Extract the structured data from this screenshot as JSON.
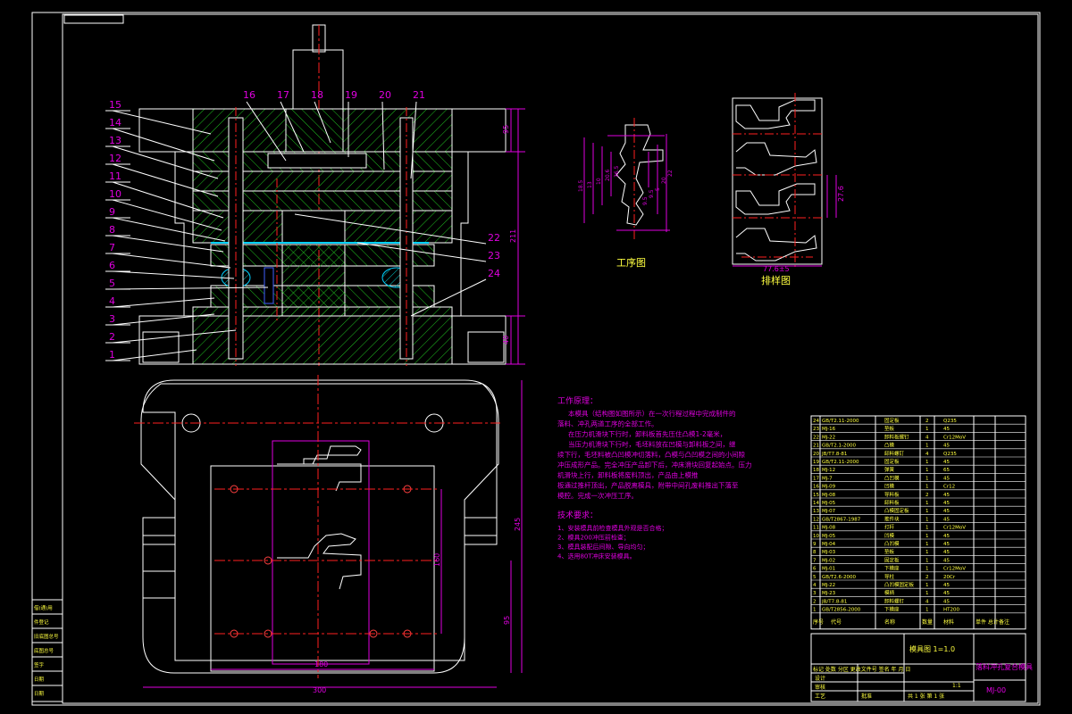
{
  "colors": {
    "background": "#000000",
    "frame": "#ffffff",
    "dimension": "#e000e0",
    "text": "#ffff40",
    "centerline": "#ff2020",
    "steel": "#20c020",
    "highlight": "#00d0ff"
  },
  "callouts_left": [
    "15",
    "14",
    "13",
    "12",
    "11",
    "10",
    "9",
    "8",
    "7",
    "6",
    "5",
    "4",
    "3",
    "2",
    "1"
  ],
  "callouts_top": [
    "16",
    "17",
    "18",
    "19",
    "20",
    "21"
  ],
  "callouts_right": [
    "22",
    "23",
    "24"
  ],
  "section_dims": {
    "top": "95",
    "total": "211",
    "bottom": "40"
  },
  "plan_dims": {
    "height": "245",
    "width_inner": "180",
    "width_total": "300",
    "inner_height": "160",
    "lower": "95"
  },
  "part_drawing": {
    "label": "工序图",
    "dims_left": [
      "18.5",
      "13",
      "10",
      "20.6",
      "36.5"
    ],
    "dims_right": [
      "9.5",
      "9.5",
      "5",
      "20",
      "22"
    ]
  },
  "strip_layout": {
    "label": "排样图",
    "pitch": "27.6",
    "width": "77.6±5"
  },
  "work_principle": {
    "heading": "工作原理：",
    "lines": [
      "本模具（结构图如图所示）在一次行程过程中完成制件的",
      "落料、冲孔两道工序的全部工作。",
      "在压力机滑块下行时，卸料板首先压住凸模1-2毫米，",
      "当压力机滑块下行时，毛坯料放在凹模与卸料板之间，继",
      "续下行，毛坯料被凸凹模冲切落料，凸模与凸凹模之间的小间隙",
      "冲压成形产品。完全冲压产品卸下后，冲床滑块回复起始点。压力",
      "机滑块上行，卸料板将废料顶出，产品由上模推",
      "板通过推杆顶出，产品脱离模具，附带中间孔废料推出下落至",
      "模腔。完成一次冲压工序。"
    ]
  },
  "tech_requirements": {
    "heading": "技术要求：",
    "items": [
      "1、安装模具前检查模具外观是否合格；",
      "2、模具200冲压前检查；",
      "3、模具装配后间隙、导向均匀；",
      "4、选用80T冲床安装模具。"
    ]
  },
  "bom_rows": [
    {
      "code": "GB/T2.11-2000",
      "name": "固定板",
      "qty": "2",
      "mat": "Q235"
    },
    {
      "code": "MJ-16",
      "name": "垫板",
      "qty": "1",
      "mat": "45"
    },
    {
      "code": "MJ-22",
      "name": "卸料板螺钉",
      "qty": "4",
      "mat": "Cr12MoV"
    },
    {
      "code": "GB/T2.1-2000",
      "name": "凸模",
      "qty": "1",
      "mat": "45"
    },
    {
      "code": "JB/T7.8-81",
      "name": "卸料螺钉",
      "qty": "4",
      "mat": "Q235"
    },
    {
      "code": "GB/T2.11-2000",
      "name": "固定板",
      "qty": "1",
      "mat": "45"
    },
    {
      "code": "MJ-12",
      "name": "弹簧",
      "qty": "1",
      "mat": "65"
    },
    {
      "code": "MJ-7",
      "name": "凸凹模",
      "qty": "1",
      "mat": "45"
    },
    {
      "code": "MJ-09",
      "name": "凹模",
      "qty": "1",
      "mat": "Cr12"
    },
    {
      "code": "MJ-08",
      "name": "导料板",
      "qty": "2",
      "mat": "45"
    },
    {
      "code": "MJ-05",
      "name": "卸料板",
      "qty": "1",
      "mat": "45"
    },
    {
      "code": "MJ-07",
      "name": "凸模固定板",
      "qty": "1",
      "mat": "45"
    },
    {
      "code": "GB/T2867-1987",
      "name": "推件块",
      "qty": "1",
      "mat": "45"
    },
    {
      "code": "MJ-08",
      "name": "打杆",
      "qty": "1",
      "mat": "Cr12MoV"
    },
    {
      "code": "MJ-05",
      "name": "凹模",
      "qty": "1",
      "mat": "45"
    },
    {
      "code": "MJ-04",
      "name": "凸凹模",
      "qty": "1",
      "mat": "45"
    },
    {
      "code": "MJ-03",
      "name": "垫板",
      "qty": "1",
      "mat": "45"
    },
    {
      "code": "MJ-02",
      "name": "固定板",
      "qty": "1",
      "mat": "45"
    },
    {
      "code": "MJ-01",
      "name": "下模座",
      "qty": "1",
      "mat": "Cr12MoV"
    },
    {
      "code": "GB/T2.6-2000",
      "name": "导柱",
      "qty": "2",
      "mat": "20Cr"
    },
    {
      "code": "MJ-22",
      "name": "凸凹模固定板",
      "qty": "1",
      "mat": "45"
    },
    {
      "code": "MJ-23",
      "name": "模柄",
      "qty": "1",
      "mat": "45"
    },
    {
      "code": "JB/T7.8-81",
      "name": "卸料螺钉",
      "qty": "4",
      "mat": "45"
    },
    {
      "code": "GB/T2856-2000",
      "name": "下模座",
      "qty": "1",
      "mat": "HT200"
    }
  ],
  "bom_header": {
    "no": "序号",
    "code": "代号",
    "name": "名称",
    "qty": "数量",
    "mat": "材料",
    "weight": "单件 总计",
    "note": "备注"
  },
  "title_block": {
    "scale_label": "模具图  1=1.0",
    "title": "落料冲孔复合模具",
    "drawing_no": "MJ-00",
    "rows": [
      "标记 处数 分区 更改文件号 签名 年 月 日",
      "设计",
      "审核",
      "工艺",
      "批准"
    ],
    "sheet": "共 1 张   第 1 张",
    "scale": "1:1"
  },
  "left_strip": [
    "借(通)用",
    "件登记",
    "旧底图总号",
    "底图总号",
    "签字",
    "日期",
    "日期"
  ]
}
